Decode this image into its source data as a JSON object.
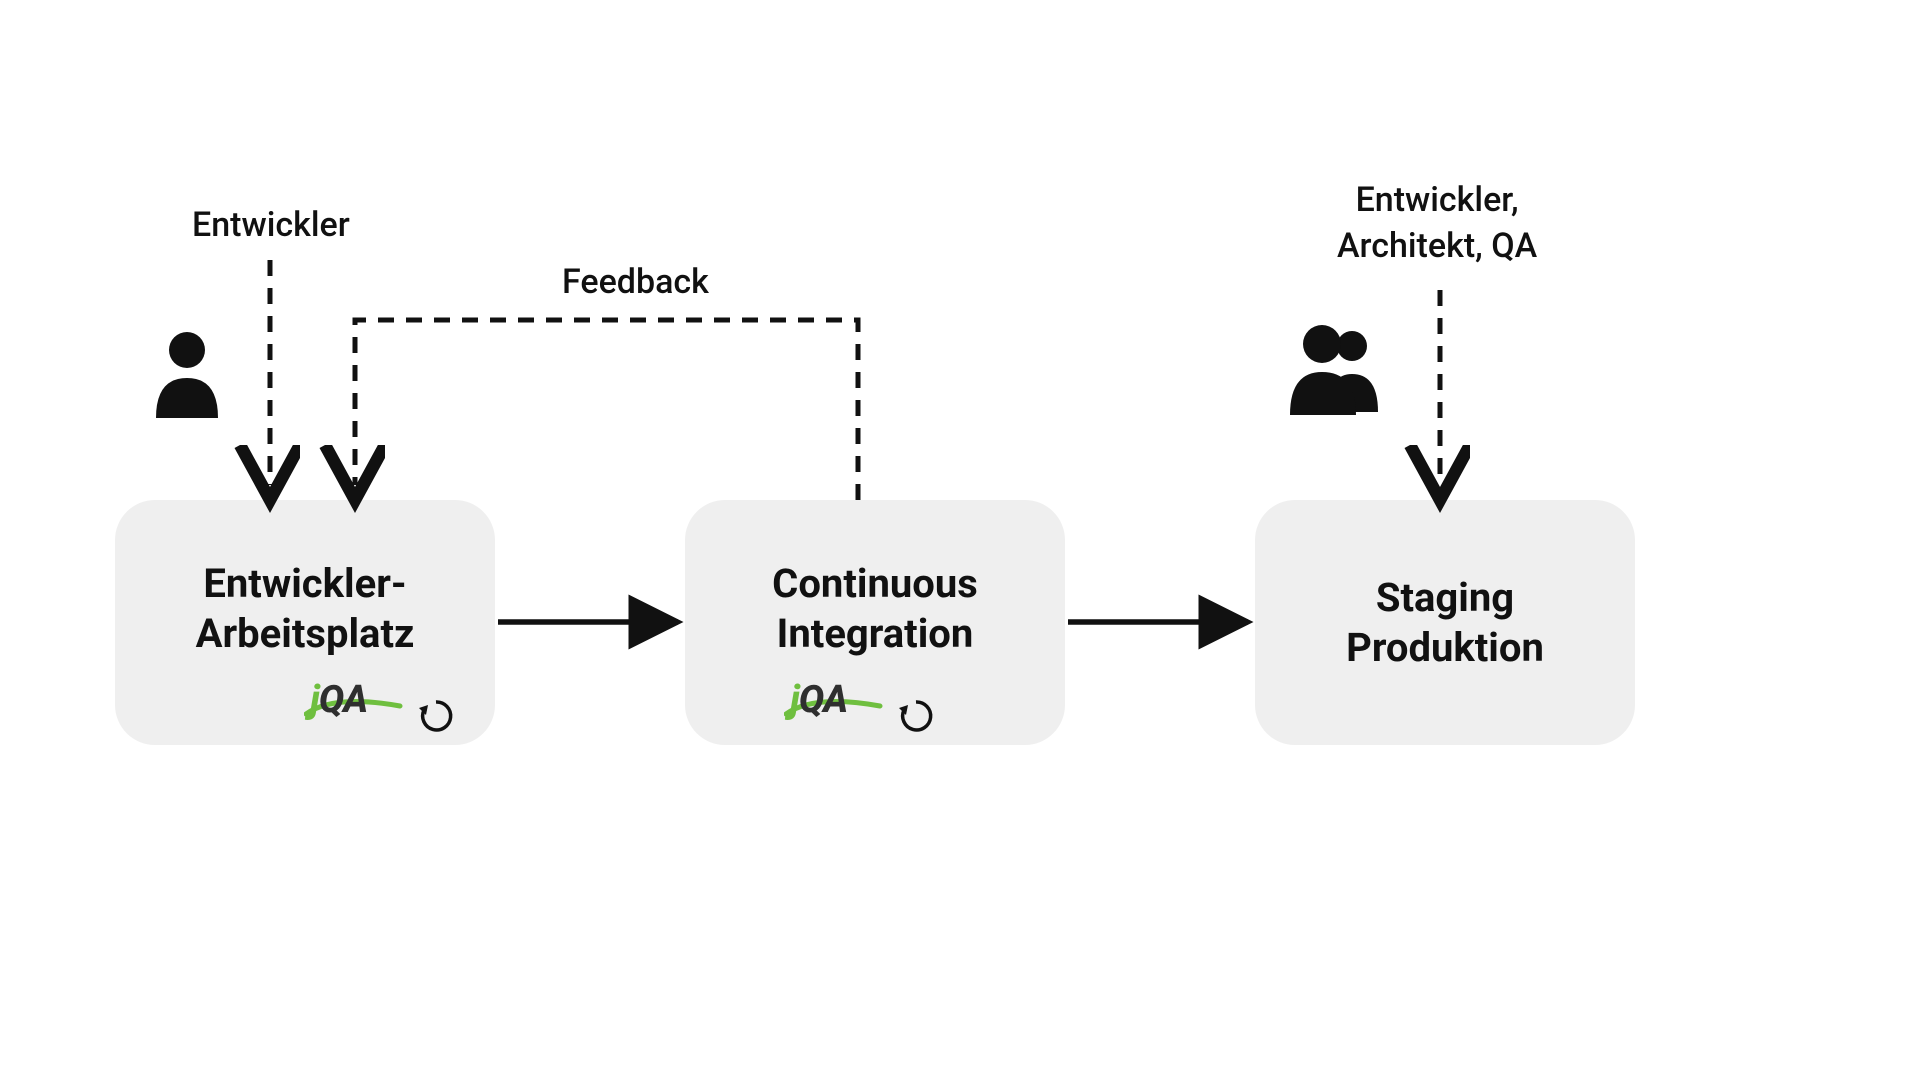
{
  "actors": {
    "developer": "Entwickler",
    "team": "Entwickler,\nArchitekt, QA"
  },
  "feedback_label": "Feedback",
  "boxes": {
    "workstation": "Entwickler-\nArbeitsplatz",
    "ci": "Continuous\nIntegration",
    "staging": "Staging\nProduktion"
  },
  "logo": {
    "j": "j",
    "qa": "QA"
  }
}
